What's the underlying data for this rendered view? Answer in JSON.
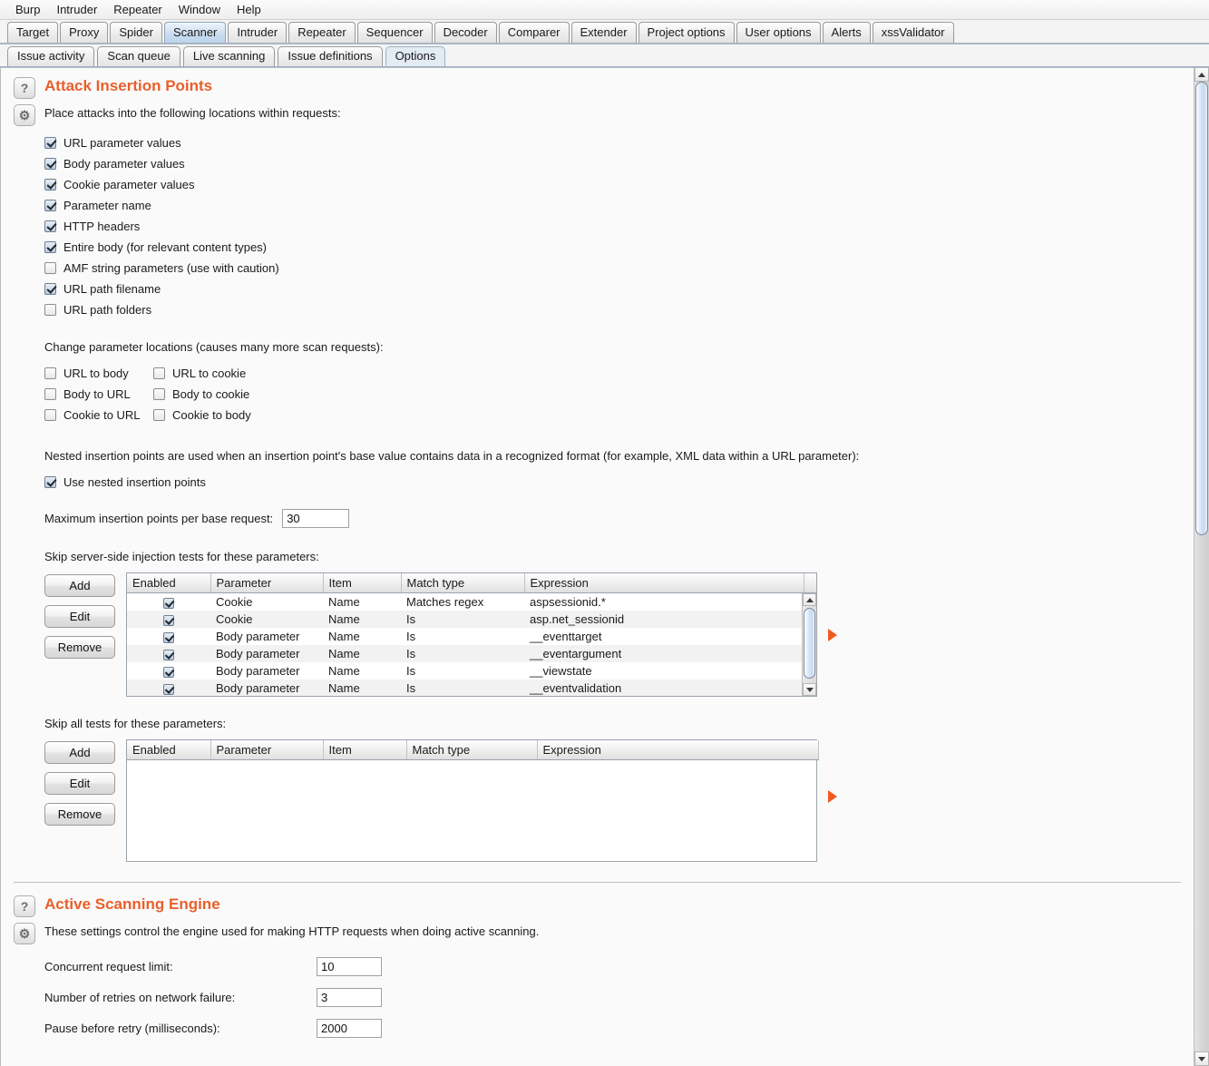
{
  "menu": {
    "items": [
      "Burp",
      "Intruder",
      "Repeater",
      "Window",
      "Help"
    ]
  },
  "main_tabs": {
    "selected": "Scanner",
    "items": [
      "Target",
      "Proxy",
      "Spider",
      "Scanner",
      "Intruder",
      "Repeater",
      "Sequencer",
      "Decoder",
      "Comparer",
      "Extender",
      "Project options",
      "User options",
      "Alerts",
      "xssValidator"
    ]
  },
  "sub_tabs": {
    "selected": "Options",
    "items": [
      "Issue activity",
      "Scan queue",
      "Live scanning",
      "Issue definitions",
      "Options"
    ]
  },
  "colors": {
    "section_heading": "#e8602c",
    "marker": "#f15a22",
    "selected_tab": "#c9dcf0"
  },
  "icons": {
    "help": "?",
    "settings": "⚙"
  },
  "attack_insertion_points": {
    "title": "Attack Insertion Points",
    "description": "Place attacks into the following locations within requests:",
    "locations": [
      {
        "label": "URL parameter values",
        "checked": true
      },
      {
        "label": "Body parameter values",
        "checked": true
      },
      {
        "label": "Cookie parameter values",
        "checked": true
      },
      {
        "label": "Parameter name",
        "checked": true
      },
      {
        "label": "HTTP headers",
        "checked": true
      },
      {
        "label": "Entire body (for relevant content types)",
        "checked": true
      },
      {
        "label": "AMF string parameters (use with caution)",
        "checked": false
      },
      {
        "label": "URL path filename",
        "checked": true
      },
      {
        "label": "URL path folders",
        "checked": false
      }
    ],
    "change_locations_label": "Change parameter locations (causes many more scan requests):",
    "change_locations": [
      {
        "label": "URL to body",
        "checked": false
      },
      {
        "label": "URL to cookie",
        "checked": false
      },
      {
        "label": "Body to URL",
        "checked": false
      },
      {
        "label": "Body to cookie",
        "checked": false
      },
      {
        "label": "Cookie to URL",
        "checked": false
      },
      {
        "label": "Cookie to body",
        "checked": false
      }
    ],
    "nested_description": "Nested insertion points are used when an insertion point's base value contains data in a recognized format (for example, XML data within a URL parameter):",
    "use_nested": {
      "label": "Use nested insertion points",
      "checked": true
    },
    "max_points": {
      "label": "Maximum insertion points per base request:",
      "value": "30"
    },
    "skip_server_side": {
      "label": "Skip server-side injection tests for these parameters:",
      "buttons": [
        "Add",
        "Edit",
        "Remove"
      ],
      "columns": [
        "Enabled",
        "Parameter",
        "Item",
        "Match type",
        "Expression"
      ],
      "rows": [
        {
          "enabled": true,
          "parameter": "Cookie",
          "item": "Name",
          "match_type": "Matches regex",
          "expression": "aspsessionid.*"
        },
        {
          "enabled": true,
          "parameter": "Cookie",
          "item": "Name",
          "match_type": "Is",
          "expression": "asp.net_sessionid"
        },
        {
          "enabled": true,
          "parameter": "Body parameter",
          "item": "Name",
          "match_type": "Is",
          "expression": "__eventtarget"
        },
        {
          "enabled": true,
          "parameter": "Body parameter",
          "item": "Name",
          "match_type": "Is",
          "expression": "__eventargument"
        },
        {
          "enabled": true,
          "parameter": "Body parameter",
          "item": "Name",
          "match_type": "Is",
          "expression": "__viewstate"
        },
        {
          "enabled": true,
          "parameter": "Body parameter",
          "item": "Name",
          "match_type": "Is",
          "expression": "__eventvalidation"
        }
      ]
    },
    "skip_all": {
      "label": "Skip all tests for these parameters:",
      "buttons": [
        "Add",
        "Edit",
        "Remove"
      ],
      "columns": [
        "Enabled",
        "Parameter",
        "Item",
        "Match type",
        "Expression"
      ],
      "rows": []
    }
  },
  "active_scanning_engine": {
    "title": "Active Scanning Engine",
    "description": "These settings control the engine used for making HTTP requests when doing active scanning.",
    "fields": [
      {
        "label": "Concurrent request limit:",
        "value": "10"
      },
      {
        "label": "Number of retries on network failure:",
        "value": "3"
      },
      {
        "label": "Pause before retry (milliseconds):",
        "value": "2000"
      }
    ]
  }
}
